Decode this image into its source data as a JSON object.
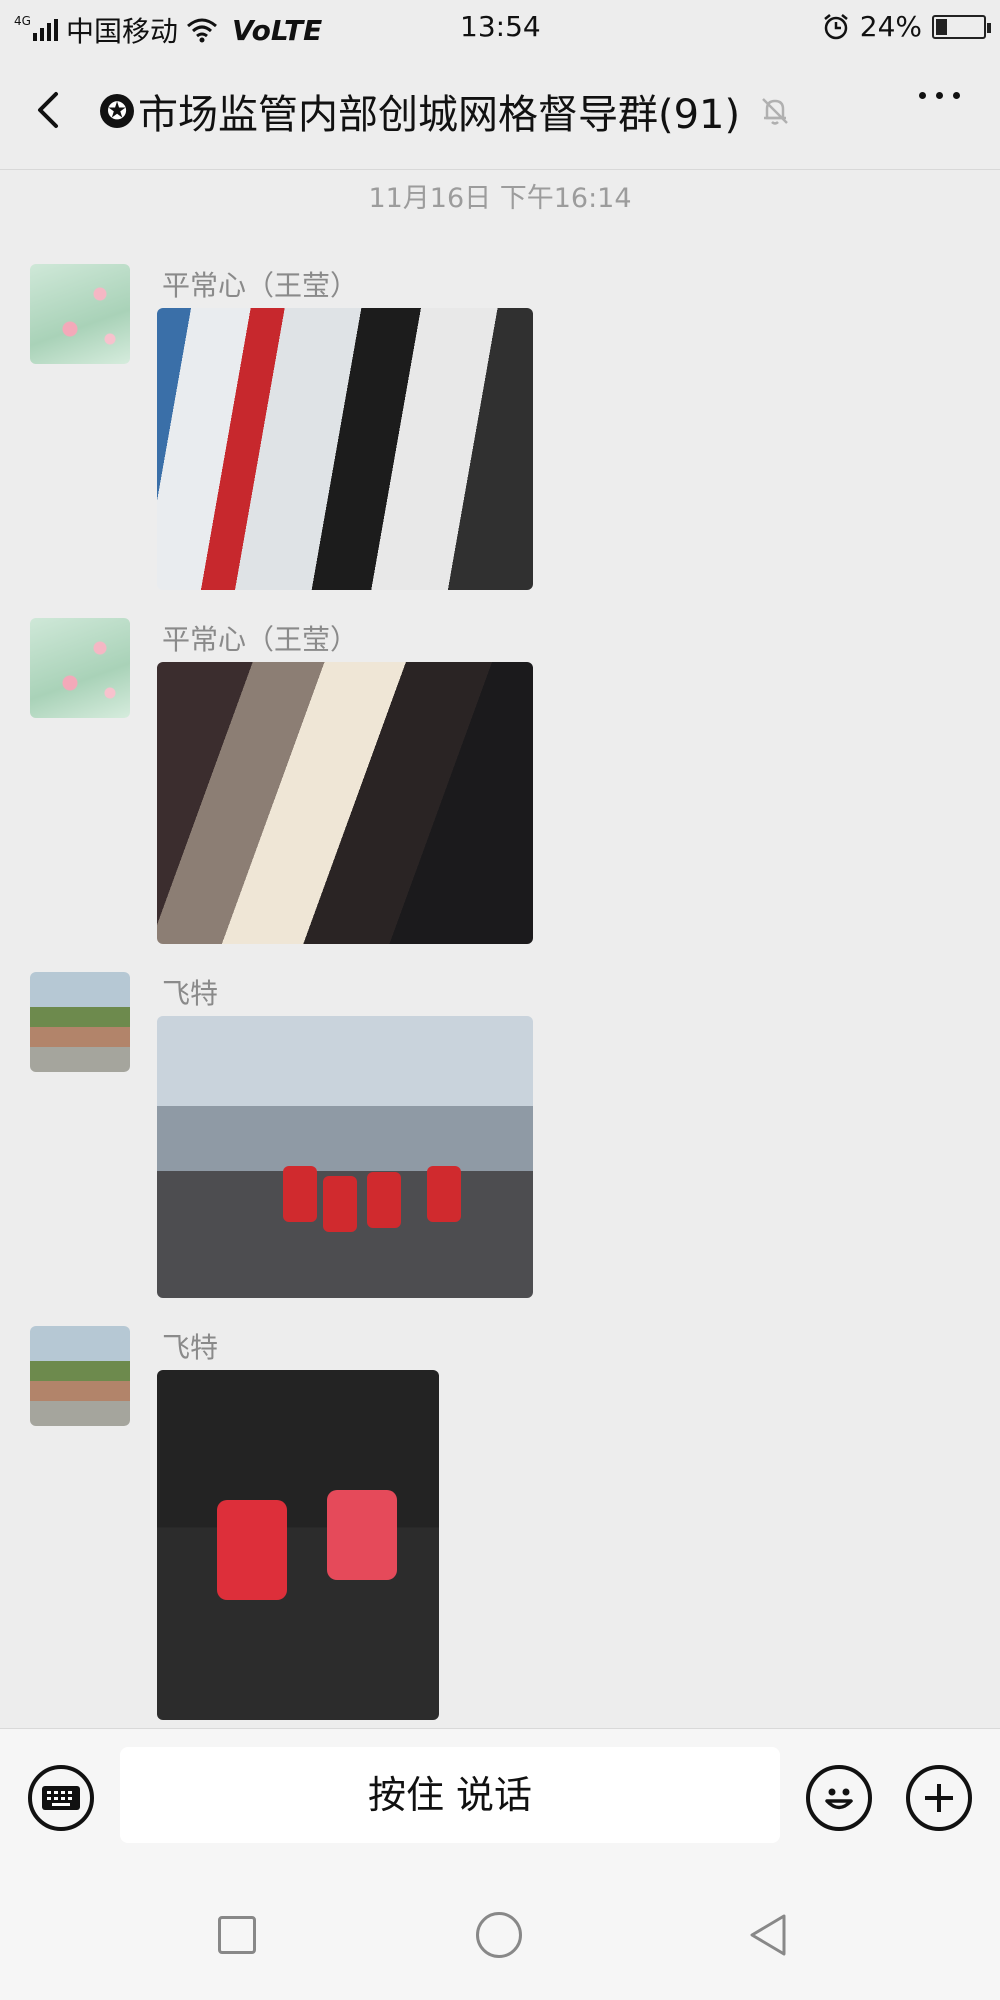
{
  "status_bar": {
    "network_tag": "4G",
    "carrier": "中国移动",
    "volte": "VoLTE",
    "time": "13:54",
    "battery_percent_text": "24%",
    "battery_level": 0.24,
    "icons": [
      "signal-icon",
      "wifi-icon",
      "alarm-icon",
      "battery-icon"
    ]
  },
  "header": {
    "title": "市场监管内部创城网格督导群(91)",
    "star_glyph": "✪"
  },
  "chat": {
    "timestamp": "11月16日 下午16:14",
    "messages": [
      {
        "sender": "平常心（王莹）",
        "type": "image"
      },
      {
        "sender": "平常心（王莹）",
        "type": "image"
      },
      {
        "sender": "飞特",
        "type": "image"
      },
      {
        "sender": "飞特",
        "type": "image"
      }
    ]
  },
  "input_bar": {
    "hold_to_talk_label": "按住 说话"
  },
  "colors": {
    "background": "#ededed",
    "bar_background": "#f6f6f6",
    "meta_text": "#9c9c9c"
  }
}
